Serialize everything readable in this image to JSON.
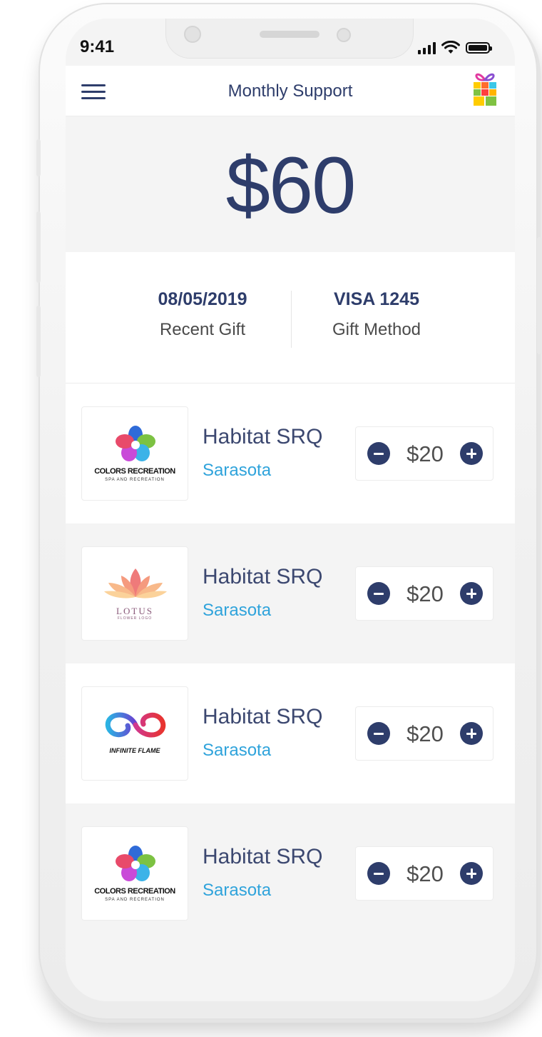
{
  "status_bar": {
    "time": "9:41"
  },
  "header": {
    "title": "Monthly Support",
    "menu_icon": "hamburger-menu-icon",
    "gift_icon": "gift-box-icon"
  },
  "summary": {
    "amount": "$60"
  },
  "info": {
    "recent_gift": {
      "value": "08/05/2019",
      "label": "Recent Gift"
    },
    "gift_method": {
      "value": "VISA 1245",
      "label": "Gift Method"
    }
  },
  "colors": {
    "primary": "#2e3d6b",
    "link": "#2fa3db",
    "background": "#f4f4f4"
  },
  "charities": [
    {
      "name": "Habitat SRQ",
      "city": "Sarasota",
      "amount": "$20",
      "logo": {
        "title": "COLORS RECREATION",
        "subtitle": "SPA AND RECREATION"
      }
    },
    {
      "name": "Habitat SRQ",
      "city": "Sarasota",
      "amount": "$20",
      "logo": {
        "title": "LOTUS",
        "subtitle": "FLOWER LOGO"
      }
    },
    {
      "name": "Habitat SRQ",
      "city": "Sarasota",
      "amount": "$20",
      "logo": {
        "title": "INFINITE FLAME",
        "subtitle": ""
      }
    },
    {
      "name": "Habitat SRQ",
      "city": "Sarasota",
      "amount": "$20",
      "logo": {
        "title": "COLORS RECREATION",
        "subtitle": "SPA AND RECREATION"
      }
    }
  ]
}
